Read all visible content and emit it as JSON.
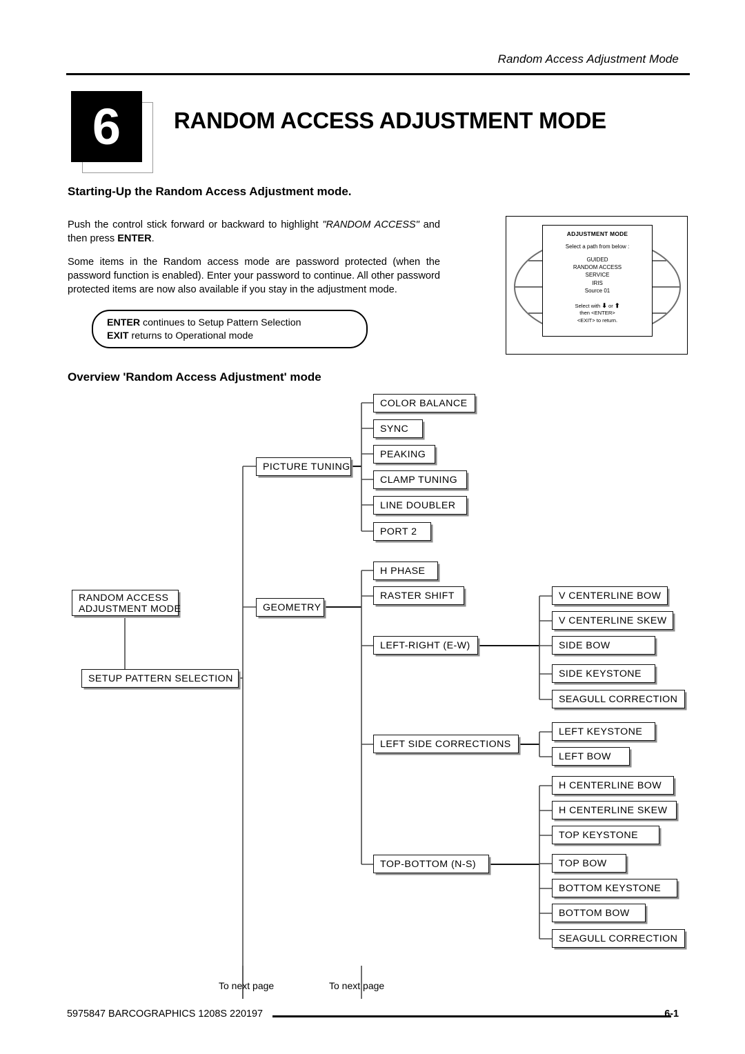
{
  "header": {
    "running_title": "Random Access Adjustment Mode",
    "chapter_number": "6",
    "chapter_title": "RANDOM ACCESS ADJUSTMENT MODE"
  },
  "sections": {
    "start_heading": "Starting-Up the Random Access Adjustment mode.",
    "overview_heading": "Overview 'Random Access Adjustment' mode"
  },
  "note_box": {
    "line1_bold": "ENTER",
    "line1_rest": " continues to Setup Pattern Selection",
    "line2_bold": "EXIT",
    "line2_rest": " returns to Operational mode"
  },
  "osd": {
    "title": "ADJUSTMENT MODE",
    "subtitle": "Select a path from below :",
    "items": [
      "GUIDED",
      "RANDOM ACCESS",
      "SERVICE",
      "IRIS",
      "Source 01"
    ],
    "foot_select_prefix": "Select with",
    "foot_arrow_down": "⬇",
    "foot_or": "or",
    "foot_arrow_up": "⬆",
    "foot_enter": "then <ENTER>",
    "foot_exit": "<EXIT> to return."
  },
  "diagram": {
    "root": "RANDOM ACCESS\nADJUSTMENT MODE",
    "root_line1": "RANDOM  ACCESS",
    "root_line2": "ADJUSTMENT MODE",
    "setup": "SETUP PATTERN SELECTION",
    "picture_tuning": "PICTURE TUNING",
    "picture_tuning_children": [
      "COLOR  BALANCE",
      "SYNC",
      "PEAKING",
      "CLAMP  TUNING",
      "LINE  DOUBLER",
      "PORT 2"
    ],
    "geometry": "GEOMETRY",
    "geometry_children": [
      "H PHASE",
      "RASTER SHIFT",
      "LEFT-RIGHT (E-W)",
      "LEFT SIDE CORRECTIONS",
      "TOP-BOTTOM (N-S)"
    ],
    "left_right_children": [
      "V CENTERLINE BOW",
      "V CENTERLINE SKEW",
      "SIDE BOW",
      "SIDE KEYSTONE",
      "SEAGULL  CORRECTION"
    ],
    "left_side_children": [
      "LEFT KEYSTONE",
      "LEFT BOW"
    ],
    "top_bottom_children": [
      "H CENTERLINE BOW",
      "H CENTERLINE SKEW",
      "TOP KEYSTONE",
      "TOP BOW",
      "BOTTOM KEYSTONE",
      "BOTTOM BOW",
      "SEAGULL  CORRECTION"
    ],
    "next_page_left": "To next page",
    "next_page_right": "To next page"
  },
  "body": {
    "para1_a": "Push the control stick forward or backward to highlight ",
    "para1_i": "\"RANDOM  ACCESS\"",
    "para1_b": " and then press ",
    "para1_bold": "ENTER",
    "para1_c": ".",
    "para2": "Some items in the Random access mode are password protected (when the password function is enabled).  Enter your password to continue.  All other password protected items are now also available if you stay in the adjustment mode."
  },
  "footer": {
    "doc_code": "5975847  BARCOGRAPHICS 1208S 220197",
    "page_number": "6-1"
  }
}
